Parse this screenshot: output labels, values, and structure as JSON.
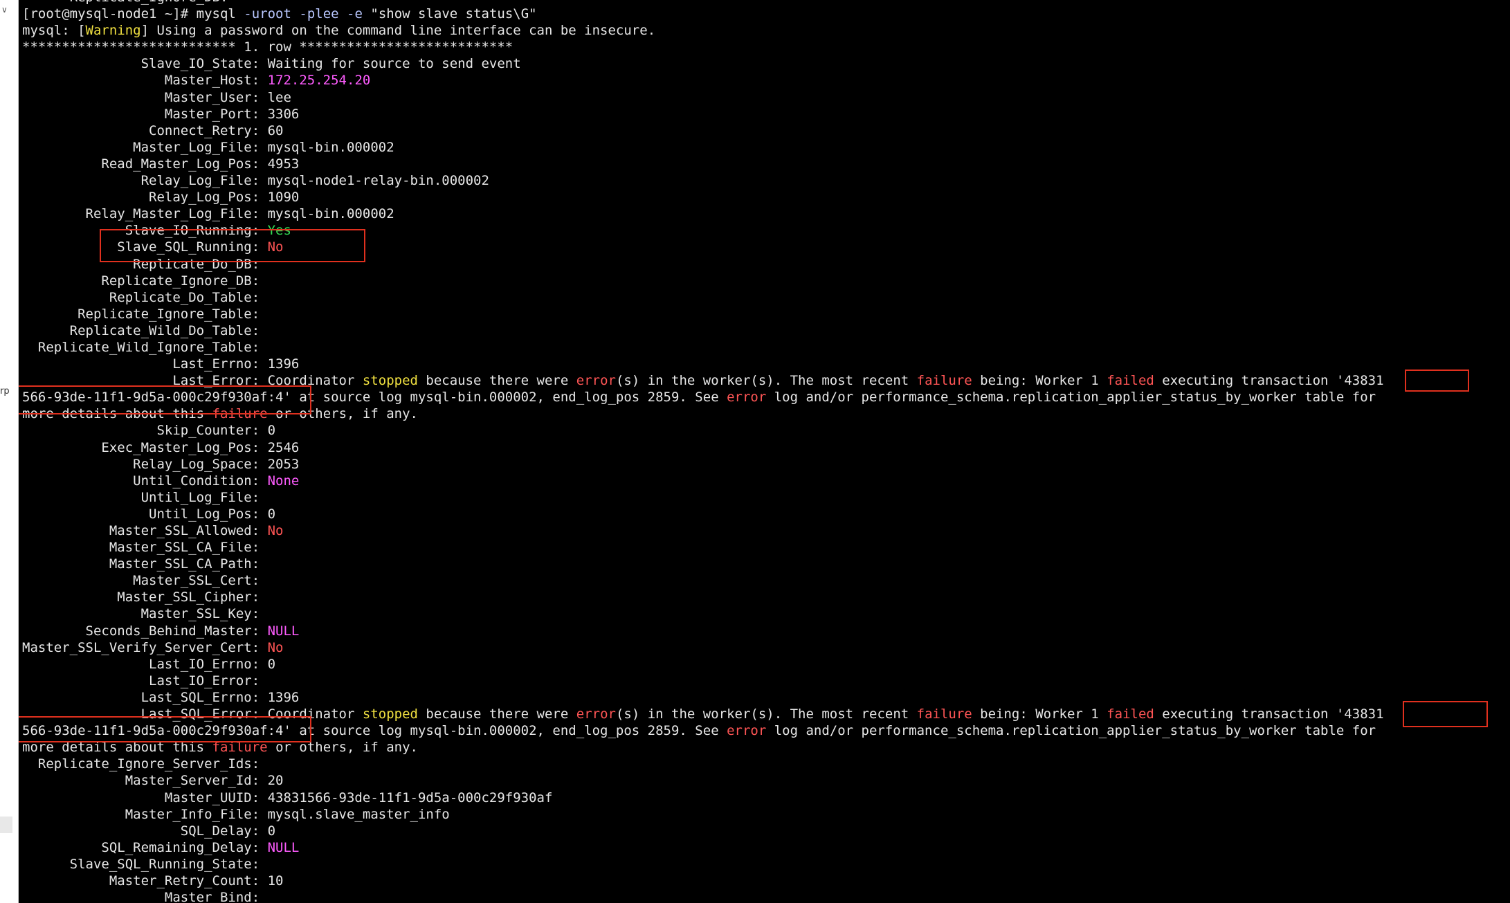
{
  "sidebar": {
    "chevron": "∨",
    "label": "rp",
    "colors": {
      "background": "#ffffff"
    }
  },
  "terminal": {
    "colors": {
      "background": "#000000",
      "text": "#e6e6e6",
      "pink": "#ff5cff",
      "yellow": "#f0e040",
      "red": "#ff5555",
      "green": "#33dd55"
    },
    "lines": [
      [
        {
          "t": "      Replicate_Ignore_DB:"
        }
      ],
      [
        {
          "t": "[root@mysql-node1 ~]# mysql "
        },
        {
          "t": "-uroot",
          "c": "cmdflag"
        },
        {
          "t": " "
        },
        {
          "t": "-plee",
          "c": "cmdflag"
        },
        {
          "t": " "
        },
        {
          "t": "-e",
          "c": "cmdflag"
        },
        {
          "t": " \"show slave status\\G\""
        }
      ],
      [
        {
          "t": "mysql: ["
        },
        {
          "t": "Warning",
          "c": "yellow"
        },
        {
          "t": "] Using a password on the command line interface can be insecure."
        }
      ],
      [
        {
          "t": "*************************** 1. row ***************************"
        }
      ],
      [
        {
          "t": "               Slave_IO_State: Waiting for source to send event"
        }
      ],
      [
        {
          "t": "                  Master_Host: "
        },
        {
          "t": "172.25.254.20",
          "c": "pink"
        }
      ],
      [
        {
          "t": "                  Master_User: lee"
        }
      ],
      [
        {
          "t": "                  Master_Port: 3306"
        }
      ],
      [
        {
          "t": "                Connect_Retry: 60"
        }
      ],
      [
        {
          "t": "              Master_Log_File: mysql-bin.000002"
        }
      ],
      [
        {
          "t": "          Read_Master_Log_Pos: 4953"
        }
      ],
      [
        {
          "t": "               Relay_Log_File: mysql-node1-relay-bin.000002"
        }
      ],
      [
        {
          "t": "                Relay_Log_Pos: 1090"
        }
      ],
      [
        {
          "t": "        Relay_Master_Log_File: mysql-bin.000002"
        }
      ],
      [
        {
          "t": "             Slave_IO_Running: "
        },
        {
          "t": "Yes",
          "c": "green"
        }
      ],
      [
        {
          "t": "            Slave_SQL_Running: "
        },
        {
          "t": "No",
          "c": "red"
        }
      ],
      [
        {
          "t": "              Replicate_Do_DB:"
        }
      ],
      [
        {
          "t": "          Replicate_Ignore_DB:"
        }
      ],
      [
        {
          "t": "           Replicate_Do_Table:"
        }
      ],
      [
        {
          "t": "       Replicate_Ignore_Table:"
        }
      ],
      [
        {
          "t": "      Replicate_Wild_Do_Table:"
        }
      ],
      [
        {
          "t": "  Replicate_Wild_Ignore_Table:"
        }
      ],
      [
        {
          "t": "                   Last_Errno: 1396"
        }
      ],
      [
        {
          "t": "                   Last_Error: Coordinator "
        },
        {
          "t": "stopped",
          "c": "yellow"
        },
        {
          "t": " because there were "
        },
        {
          "t": "error",
          "c": "red"
        },
        {
          "t": "(s) in the worker(s). The most recent "
        },
        {
          "t": "failure",
          "c": "red"
        },
        {
          "t": " being: Worker 1 "
        },
        {
          "t": "failed",
          "c": "red"
        },
        {
          "t": " executing transaction '43831"
        }
      ],
      [
        {
          "t": "566-93de-11f1-9d5a-000c29f930af:4' at source log mysql-bin.000002, end_log_pos 2859. See "
        },
        {
          "t": "error",
          "c": "red"
        },
        {
          "t": " log and/or performance_schema.replication_applier_status_by_worker table for"
        }
      ],
      [
        {
          "t": "more details about this "
        },
        {
          "t": "failure",
          "c": "red"
        },
        {
          "t": " or others, if any."
        }
      ],
      [
        {
          "t": "                 Skip_Counter: 0"
        }
      ],
      [
        {
          "t": "          Exec_Master_Log_Pos: 2546"
        }
      ],
      [
        {
          "t": "              Relay_Log_Space: 2053"
        }
      ],
      [
        {
          "t": "              Until_Condition: "
        },
        {
          "t": "None",
          "c": "pink"
        }
      ],
      [
        {
          "t": "               Until_Log_File:"
        }
      ],
      [
        {
          "t": "                Until_Log_Pos: 0"
        }
      ],
      [
        {
          "t": "           Master_SSL_Allowed: "
        },
        {
          "t": "No",
          "c": "red"
        }
      ],
      [
        {
          "t": "           Master_SSL_CA_File:"
        }
      ],
      [
        {
          "t": "           Master_SSL_CA_Path:"
        }
      ],
      [
        {
          "t": "              Master_SSL_Cert:"
        }
      ],
      [
        {
          "t": "            Master_SSL_Cipher:"
        }
      ],
      [
        {
          "t": "               Master_SSL_Key:"
        }
      ],
      [
        {
          "t": "        Seconds_Behind_Master: "
        },
        {
          "t": "NULL",
          "c": "pink"
        }
      ],
      [
        {
          "t": "Master_SSL_Verify_Server_Cert: "
        },
        {
          "t": "No",
          "c": "red"
        }
      ],
      [
        {
          "t": "                Last_IO_Errno: 0"
        }
      ],
      [
        {
          "t": "                Last_IO_Error:"
        }
      ],
      [
        {
          "t": "               Last_SQL_Errno: 1396"
        }
      ],
      [
        {
          "t": "               Last_SQL_Error: Coordinator "
        },
        {
          "t": "stopped",
          "c": "yellow"
        },
        {
          "t": " because there were "
        },
        {
          "t": "error",
          "c": "red"
        },
        {
          "t": "(s) in the worker(s). The most recent "
        },
        {
          "t": "failure",
          "c": "red"
        },
        {
          "t": " being: Worker 1 "
        },
        {
          "t": "failed",
          "c": "red"
        },
        {
          "t": " executing transaction '43831"
        }
      ],
      [
        {
          "t": "566-93de-11f1-9d5a-000c29f930af:4' at source log mysql-bin.000002, end_log_pos 2859. See "
        },
        {
          "t": "error",
          "c": "red"
        },
        {
          "t": " log and/or performance_schema.replication_applier_status_by_worker table for"
        }
      ],
      [
        {
          "t": "more details about this "
        },
        {
          "t": "failure",
          "c": "red"
        },
        {
          "t": " or others, if any."
        }
      ],
      [
        {
          "t": "  Replicate_Ignore_Server_Ids:"
        }
      ],
      [
        {
          "t": "             Master_Server_Id: 20"
        }
      ],
      [
        {
          "t": "                  Master_UUID: 43831566-93de-11f1-9d5a-000c29f930af"
        }
      ],
      [
        {
          "t": "             Master_Info_File: mysql.slave_master_info"
        }
      ],
      [
        {
          "t": "                    SQL_Delay: 0"
        }
      ],
      [
        {
          "t": "          SQL_Remaining_Delay: "
        },
        {
          "t": "NULL",
          "c": "pink"
        }
      ],
      [
        {
          "t": "      Slave_SQL_Running_State:"
        }
      ],
      [
        {
          "t": "           Master_Retry_Count: 10"
        }
      ],
      [
        {
          "t": "                  Master_Bind:"
        }
      ]
    ]
  }
}
